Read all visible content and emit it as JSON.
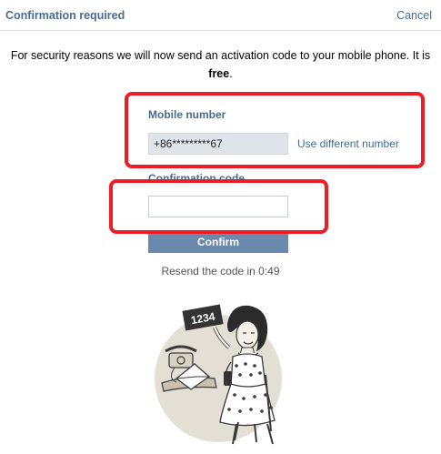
{
  "header": {
    "title": "Confirmation required",
    "cancel_label": "Cancel"
  },
  "intro": {
    "text": "For security reasons we will now send an activation code to your mobile phone. It is",
    "emphasis": "free",
    "trailing": "."
  },
  "mobile": {
    "label": "Mobile number",
    "value": "+86*********67",
    "change_link": "Use different number"
  },
  "code": {
    "label": "Confirmation code",
    "value": "",
    "placeholder": ""
  },
  "confirm_button": "Confirm",
  "resend": "Resend the code in 0:49",
  "illustration": {
    "sign_text": "1234"
  },
  "colors": {
    "link": "#3f6a99",
    "label": "#4a6b8f",
    "button": "#6b89ac",
    "highlight": "#ee1c24"
  },
  "icons": [
    "woman-holding-sign-illustration",
    "telephone-icon",
    "envelope-icon"
  ]
}
